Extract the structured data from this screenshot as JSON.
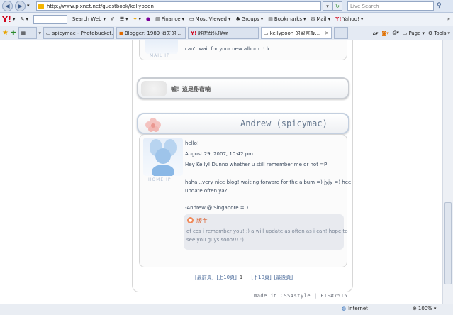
{
  "browser": {
    "url": "http://www.pixnet.net/guestbook/kellypoon",
    "search_placeholder": "Live Search"
  },
  "yahoo_toolbar": {
    "search_web_label": "Search Web",
    "finance_label": "Finance",
    "most_viewed_label": "Most Viewed",
    "groups_label": "Groups",
    "bookmarks_label": "Bookmarks",
    "mail_label": "Mail",
    "yahoo_label": "Yahoo!"
  },
  "tabs": [
    {
      "label": "spicymac - Photobucket..."
    },
    {
      "label": "Blogger: 1989 消失的..."
    },
    {
      "label": "雅虎音乐搜索"
    },
    {
      "label": "kellypoon 的留言板..."
    }
  ],
  "command_bar": {
    "page_label": "Page",
    "tools_label": "Tools"
  },
  "guestbook": {
    "prev_entry_text": "can't wait for your new album !! lc",
    "prev_avatar_label": "MAIL IP",
    "secret_message": "噓！這是秘密喃",
    "entry": {
      "author": "Andrew (spicymac)",
      "avatar_label": "HOME IP",
      "greeting": "hello!",
      "date": "August 29, 2007, 10:42 pm",
      "line1": "Hey Kelly! Dunno whether u still remember me or not =P",
      "line2": "haha...very nice blog! waiting forward for the album =) jyjy =) hee~",
      "line3": "update often ya?",
      "signature": "-Andrew @ Singapore =D",
      "reply_label": "版主",
      "reply_text_1": "of cos i remember you! :) a will update as often as i can! hope to",
      "reply_text_2": "see you guys soon!!! :)"
    },
    "pagination": {
      "first": "[最前頁]",
      "prev10": "[上10頁]",
      "current": "1",
      "next10": "[下10頁]",
      "last": "[最後頁]"
    },
    "footer_text": "made in CSS4style | FIS#7515"
  },
  "status": {
    "zone": "Internet",
    "zoom": "100%"
  }
}
